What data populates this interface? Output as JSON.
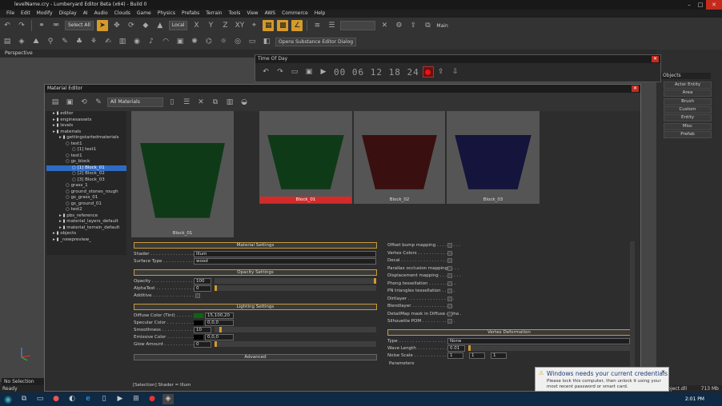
{
  "app": {
    "title": "levelName.cry - Lumberyard Editor Beta (x64) - Build 0",
    "menu": [
      "File",
      "Edit",
      "Modify",
      "Display",
      "AI",
      "Audio",
      "Clouds",
      "Game",
      "Physics",
      "Prefabs",
      "Terrain",
      "Tools",
      "View",
      "AWS",
      "Commerce",
      "Help"
    ]
  },
  "toolbar": {
    "select_mode": "Select All",
    "coord": "Local",
    "layer": "Main",
    "substance_tooltip": "Opens Substance Editor Dialog"
  },
  "viewport": {
    "label": "Perspective"
  },
  "statusbar": {
    "left": "Ready",
    "selection": "No Selection",
    "right": "mplesProject.dll",
    "mem": "713 Mb"
  },
  "taskbar": {
    "clock": "2:01 PM"
  },
  "right_panel": {
    "header": "Objects",
    "buttons": [
      "Actor Entity",
      "Area",
      "Brush",
      "Custom",
      "Entity",
      "Misc",
      "Prefab"
    ]
  },
  "time_of_day": {
    "title": "Time Of Day",
    "time": "00 06 12 18 24"
  },
  "material_editor": {
    "title": "Material Editor",
    "filter": "All Materials",
    "tree": [
      {
        "label": "editor",
        "depth": 1
      },
      {
        "label": "enginesassets",
        "depth": 1
      },
      {
        "label": "levels",
        "depth": 1
      },
      {
        "label": "materials",
        "depth": 1
      },
      {
        "label": "gettingstartedmaterials",
        "depth": 2
      },
      {
        "label": "test1",
        "depth": 3
      },
      {
        "label": "[1] test1",
        "depth": 4
      },
      {
        "label": "test1",
        "depth": 3
      },
      {
        "label": "gs_block",
        "depth": 3
      },
      {
        "label": "[1] Block_01",
        "depth": 4,
        "selected": true
      },
      {
        "label": "[2] Block_02",
        "depth": 4
      },
      {
        "label": "[3] Block_03",
        "depth": 4
      },
      {
        "label": "grass_1",
        "depth": 3
      },
      {
        "label": "ground_stones_rough",
        "depth": 3
      },
      {
        "label": "gs_grass_01",
        "depth": 3
      },
      {
        "label": "gs_ground_01",
        "depth": 3
      },
      {
        "label": "test2",
        "depth": 3
      },
      {
        "label": "pbs_reference",
        "depth": 2
      },
      {
        "label": "material_layers_default",
        "depth": 2
      },
      {
        "label": "material_terrain_default",
        "depth": 2
      },
      {
        "label": "objects",
        "depth": 1
      },
      {
        "label": "_newpreview_",
        "depth": 1
      }
    ],
    "previews": [
      {
        "label": "Block_01",
        "color": "#0f3a18"
      },
      {
        "label": "Block_01",
        "color": "#0f3a18",
        "selected": true
      },
      {
        "label": "Block_02",
        "color": "#3a0f0f"
      },
      {
        "label": "Block_03",
        "color": "#14143c"
      }
    ],
    "sections": {
      "material": "Material Settings",
      "opacity": "Opacity Settings",
      "lighting": "Lighting Settings",
      "advanced": "Advanced",
      "vertex": "Vertex Deformation"
    },
    "props": {
      "shader_label": "Shader . . . . . . . . . . . . . . . .",
      "shader": "Illum",
      "surface_label": "Surface Type . . . . . . . . . . . .",
      "surface": "wood",
      "opacity_label": "Opacity . . . . . . . . . . . . . . . . .",
      "opacity": "100",
      "alphatest_label": "AlphaTest . . . . . . . . . . . . . .",
      "alphatest": "0",
      "additive_label": "Additive . . . . . . . . . . . . . . . .",
      "diffuse_label": "Diffuse Color (Tint) . . . . . . .",
      "diffuse": "15,100,20",
      "specular_label": "Specular Color . . . . . . . . . . .",
      "specular": "0,0,0",
      "smooth_label": "Smoothness . . . . . . . . . . . . .",
      "smooth": "10",
      "emissive_label": "Emissive Color . . . . . . . . . . .",
      "emissive": "0,0,0",
      "glow_label": "Glow Amount . . . . . . . . . . . . .",
      "glow": "0"
    },
    "flags": [
      "Offset bump mapping . . . . . . . . .",
      "Vertex Colors . . . . . . . . . . . . .",
      "Decal . . . . . . . . . . . . . . . . . .",
      "Parallax occlusion mapping . . . .",
      "Displacement mapping . . . . . . . .",
      "Phong tessellation . . . . . . . . . .",
      "PN triangles tessellation . . . . .",
      "Dirtlayer . . . . . . . . . . . . . . . . .",
      "Blendlayer . . . . . . . . . . . . . . .",
      "DetailMap mask in Diffuse alpha .",
      "Silhouette POM . . . . . . . . . . . ."
    ],
    "vertex": {
      "type_label": "Type . . . . . . . . . . . . . . . . .",
      "type": "None",
      "wave_label": "Wave Length . . . . . . . . . . . .",
      "wave": "0.01",
      "noise_label": "Noise Scale . . . . . . . . . . . .",
      "noise": [
        "1",
        "1",
        "1"
      ],
      "params": "Parameters"
    },
    "status": "[Selection] Shader = Illum"
  },
  "notification": {
    "title": "Windows needs your current credentials",
    "body": "Please lock this computer, then unlock it using your most recent password or smart card."
  }
}
